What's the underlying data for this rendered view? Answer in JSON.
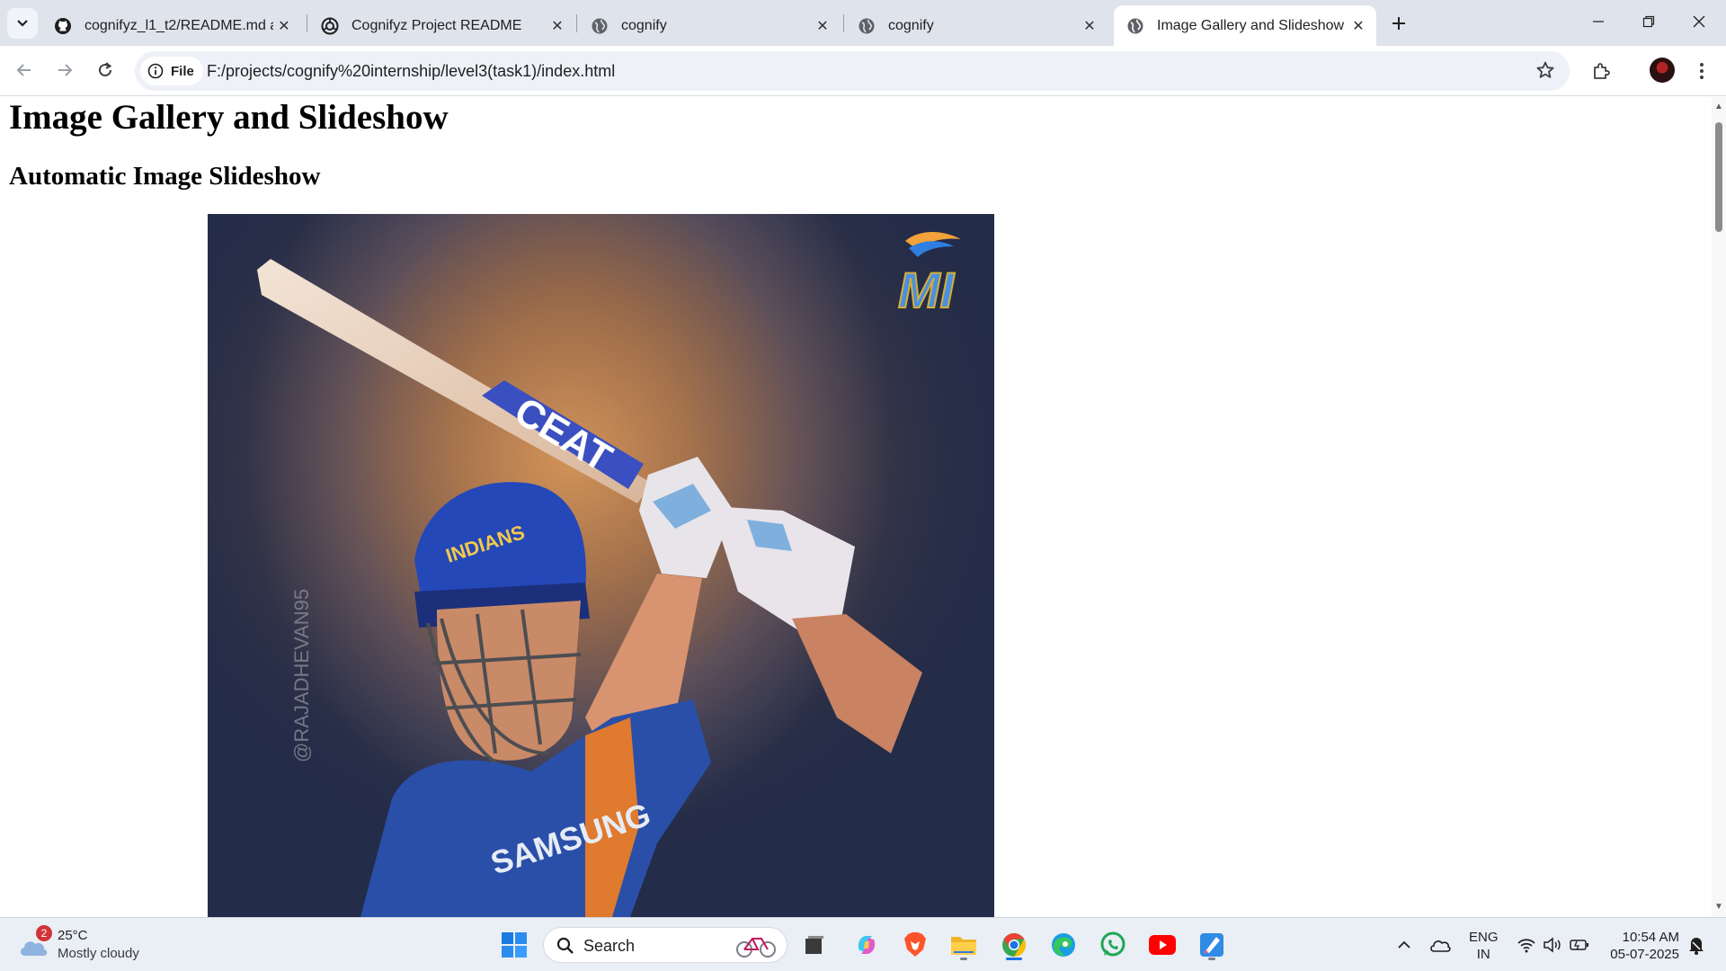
{
  "browser": {
    "tabs": [
      {
        "title": "cognifyz_l1_t2/README.md at m",
        "favicon": "github-icon",
        "active": false
      },
      {
        "title": "Cognifyz Project README",
        "favicon": "openai-icon",
        "active": false
      },
      {
        "title": "cognify",
        "favicon": "globe-icon",
        "active": false
      },
      {
        "title": "cognify",
        "favicon": "globe-icon",
        "active": false
      },
      {
        "title": "Image Gallery and Slideshow",
        "favicon": "globe-icon",
        "active": true
      }
    ],
    "site_chip_label": "File",
    "url": "F:/projects/cognify%20internship/level3(task1)/index.html"
  },
  "page": {
    "heading": "Image Gallery and Slideshow",
    "subheading": "Automatic Image Slideshow",
    "slide": {
      "brand_text": "CEAT",
      "jersey_text": "SAMSUNG",
      "helmet_text": "INDIANS",
      "watermark": "@RAJADHEVAN95",
      "logo_text": "MI"
    }
  },
  "taskbar": {
    "weather_badge": "2",
    "weather_temp": "25°C",
    "weather_desc": "Mostly cloudy",
    "search_label": "Search",
    "lang_line1": "ENG",
    "lang_line2": "IN",
    "time": "10:54 AM",
    "date": "05-07-2025",
    "apps": [
      "task-view-icon",
      "copilot-icon",
      "brave-icon",
      "file-explorer-icon",
      "chrome-icon",
      "edge-icon",
      "whatsapp-icon",
      "youtube-icon",
      "paint-icon"
    ]
  },
  "colors": {
    "tabstrip_bg": "#dfe3eb",
    "taskbar_bg": "#eaeef5",
    "accent": "#1a73e8"
  }
}
